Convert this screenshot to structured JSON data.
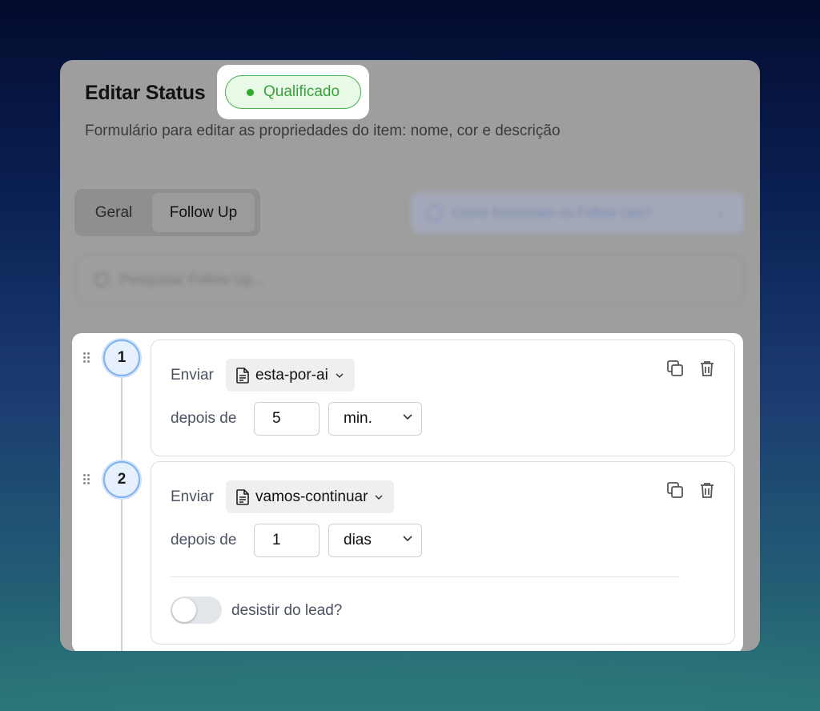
{
  "modal": {
    "title": "Editar Status",
    "status_badge": "Qualificado",
    "status_color": "#3aa13e",
    "subtitle": "Formulário para editar as propriedades do item: nome, cor e descrição"
  },
  "tabs": [
    {
      "label": "Geral",
      "active": false
    },
    {
      "label": "Follow Up",
      "active": true
    }
  ],
  "help_dropdown": {
    "label": "Como funcionam os Follow Ups?",
    "icon": "question-circle-icon"
  },
  "search": {
    "placeholder": "Pesquisar Follow Up..."
  },
  "steps": [
    {
      "number": "1",
      "send_label": "Enviar",
      "template": "esta-por-ai",
      "after_label": "depois de",
      "amount": "5",
      "unit": "min."
    },
    {
      "number": "2",
      "send_label": "Enviar",
      "template": "vamos-continuar",
      "after_label": "depois de",
      "amount": "1",
      "unit": "dias",
      "giveup_label": "desistir do lead?",
      "giveup_enabled": false
    }
  ]
}
